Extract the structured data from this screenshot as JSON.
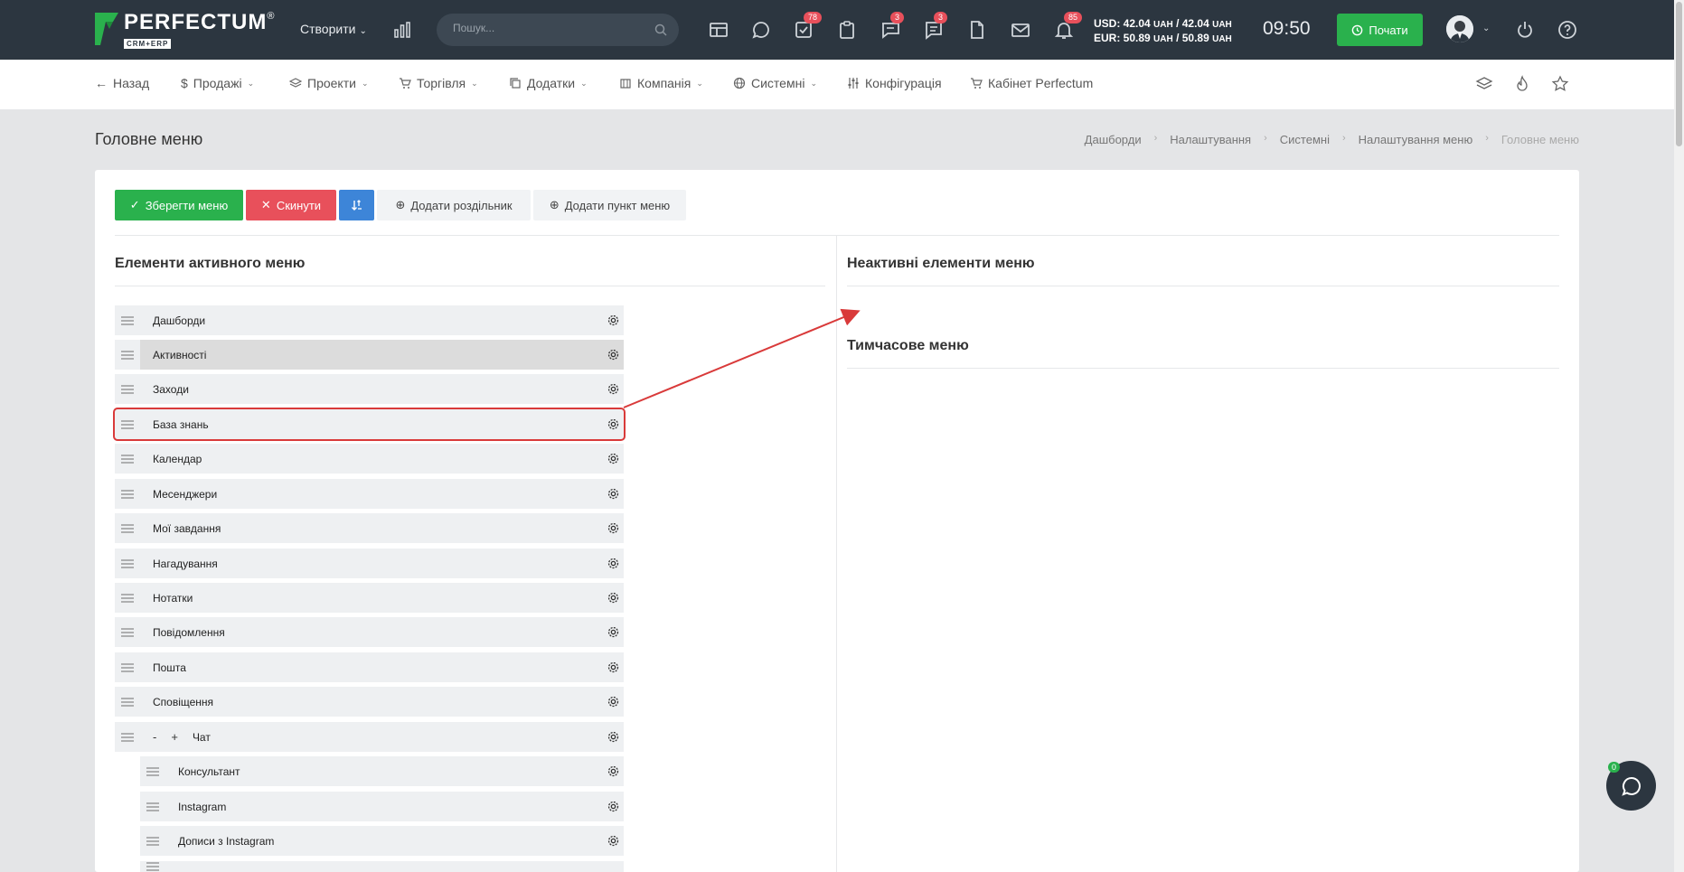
{
  "topbar": {
    "logo_name": "PERFECTUM",
    "logo_reg": "®",
    "logo_sub": "CRM+ERP",
    "create_label": "Створити",
    "search_placeholder": "Пошук...",
    "badges": {
      "tasks": "78",
      "chat": "3",
      "messages": "3",
      "notifications": "85"
    },
    "currency_usd": "USD: 42.04",
    "currency_usd_2": "/ 42.04",
    "currency_eur": "EUR: 50.89",
    "currency_eur_2": "/ 50.89",
    "currency_unit": "UAH",
    "time": "09:50",
    "start_label": "Почати"
  },
  "menubar": {
    "back": "Назад",
    "sales": "Продажі",
    "projects": "Проекти",
    "trade": "Торгівля",
    "addons": "Додатки",
    "company": "Компанія",
    "system": "Системні",
    "config": "Конфігурація",
    "cabinet": "Кабінет Perfectum"
  },
  "page": {
    "title": "Головне меню",
    "breadcrumb": [
      "Дашборди",
      "Налаштування",
      "Системні",
      "Налаштування меню",
      "Головне меню"
    ]
  },
  "toolbar": {
    "save": "Зберегти меню",
    "reset": "Скинути",
    "add_separator": "Додати роздільник",
    "add_item": "Додати пункт меню"
  },
  "sections": {
    "active": "Елементи активного меню",
    "inactive": "Неактивні елементи меню",
    "temporary": "Тимчасове меню"
  },
  "menu_items": [
    "Дашборди",
    "Активності",
    "Заходи",
    "База знань",
    "Календар",
    "Месенджери",
    "Мої завдання",
    "Нагадування",
    "Нотатки",
    "Повідомлення",
    "Пошта",
    "Сповіщення",
    "Чат",
    "Консультант",
    "Instagram",
    "Дописи з Instagram"
  ],
  "chat_toggle": {
    "collapse": "-",
    "expand": "+"
  },
  "chat_fab_badge": "0",
  "colors": {
    "topbar": "#2c3640",
    "green": "#2ab14d",
    "red": "#e8505b",
    "blue": "#3d85d8",
    "highlight": "#d93a3a"
  }
}
